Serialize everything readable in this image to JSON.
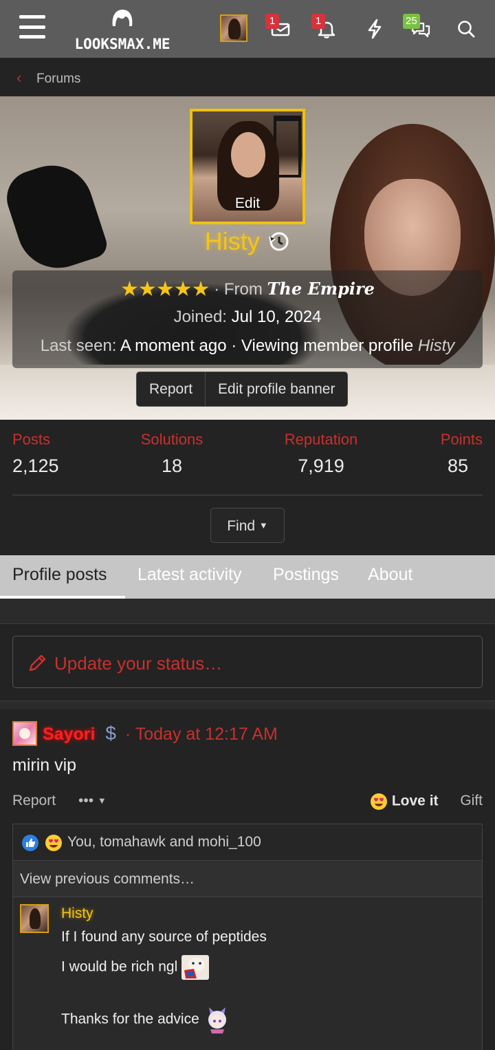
{
  "header": {
    "logo_text": "LOOKSMAX.ME",
    "conversations_badge": "1",
    "alerts_badge": "1",
    "chats_badge": "25",
    "icons": [
      "menu-icon",
      "logo-icon",
      "avatar",
      "envelope-icon",
      "bell-icon",
      "bolt-icon",
      "chat-bubbles-icon",
      "search-icon"
    ]
  },
  "breadcrumb": {
    "label": "Forums"
  },
  "profile": {
    "avatar_edit_label": "Edit",
    "username": "Histy",
    "stars": "★★★★★",
    "from_prefix": "· From",
    "from_place": "The Empire",
    "joined_label": "Joined:",
    "joined_date": "Jul 10, 2024",
    "last_seen_label": "Last seen:",
    "last_seen_value": "A moment ago",
    "activity_text": "· Viewing member profile",
    "activity_target": "Histy",
    "report_label": "Report",
    "edit_banner_label": "Edit profile banner"
  },
  "stats": [
    {
      "label": "Posts",
      "value": "2,125"
    },
    {
      "label": "Solutions",
      "value": "18"
    },
    {
      "label": "Reputation",
      "value": "7,919"
    },
    {
      "label": "Points",
      "value": "85"
    }
  ],
  "find_label": "Find",
  "tabs": [
    {
      "label": "Profile posts"
    },
    {
      "label": "Latest activity"
    },
    {
      "label": "Postings"
    },
    {
      "label": "About"
    }
  ],
  "status_placeholder": "Update your status…",
  "post": {
    "author": "Sayori",
    "time": "· Today at 12:17 AM",
    "body": "mirin vip",
    "report_label": "Report",
    "more_label": "•••",
    "love_label": "Love it",
    "gift_label": "Gift",
    "reactions_text": "You, tomahawk and mohi_100",
    "view_previous": "View previous comments…",
    "comment": {
      "author": "Histy",
      "line1": "If I found any source of peptides",
      "line2": "I would be rich ngl",
      "line3": "Thanks for the advice"
    }
  },
  "colors": {
    "accent_red": "#c9302c",
    "username_gold": "#f5c518",
    "header_bg": "#5c5c5c",
    "tabs_bg": "#c6c6c6"
  }
}
